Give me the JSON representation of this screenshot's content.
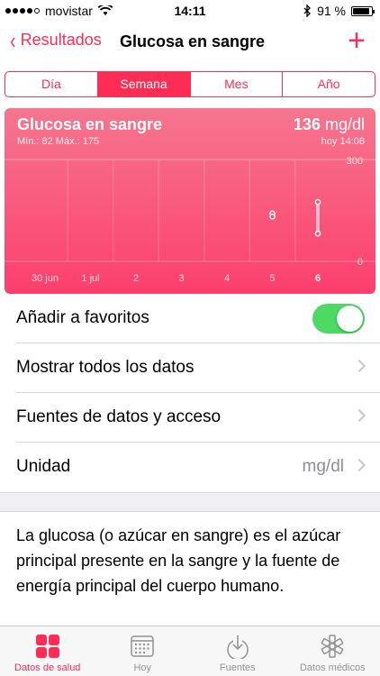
{
  "status_bar": {
    "carrier": "movistar",
    "time": "14:11",
    "battery_percent": "91 %",
    "battery_level": 0.91
  },
  "nav": {
    "back_label": "Resultados",
    "title": "Glucosa en sangre",
    "add_icon": "plus-icon"
  },
  "segments": {
    "items": [
      "Día",
      "Semana",
      "Mes",
      "Año"
    ],
    "selected": "Semana"
  },
  "chart_data": {
    "type": "scatter",
    "title": "Glucosa en sangre",
    "latest_value": "136",
    "unit": "mg/dl",
    "min_max": "Mín.: 82  Máx.: 175",
    "timestamp": "hoy 14:08",
    "x_categories": [
      "30 jun",
      "1 jul",
      "2",
      "3",
      "4",
      "5",
      "6"
    ],
    "ylim": [
      0,
      300
    ],
    "y_tick_labels": [
      "300",
      "0"
    ],
    "series": [
      {
        "points": [
          {
            "x": "5",
            "y": 141
          },
          {
            "x": "5",
            "y": 132
          },
          {
            "x": "6",
            "y": 175
          },
          {
            "x": "6",
            "y": 82
          }
        ]
      }
    ],
    "range_bars": [
      {
        "x": "6",
        "low": 82,
        "high": 175
      }
    ],
    "background_color": "#fc4f78"
  },
  "rows": {
    "favorites": {
      "label": "Añadir a favoritos",
      "toggle_on": true
    },
    "show_all": {
      "label": "Mostrar todos los datos"
    },
    "sources": {
      "label": "Fuentes de datos y acceso"
    },
    "unit": {
      "label": "Unidad",
      "value": "mg/dl"
    }
  },
  "description": "La glucosa (o azúcar en sangre) es el azúcar principal presente en la sangre y la fuente de energía principal del cuerpo humano.",
  "tabbar": {
    "items": [
      {
        "label": "Datos de salud",
        "icon": "grid-icon",
        "active": true
      },
      {
        "label": "Hoy",
        "icon": "calendar-icon",
        "active": false
      },
      {
        "label": "Fuentes",
        "icon": "download-icon",
        "active": false
      },
      {
        "label": "Datos médicos",
        "icon": "medical-star-icon",
        "active": false
      }
    ]
  },
  "colors": {
    "accent": "#ff2d55",
    "toggle_on": "#4cd964"
  }
}
